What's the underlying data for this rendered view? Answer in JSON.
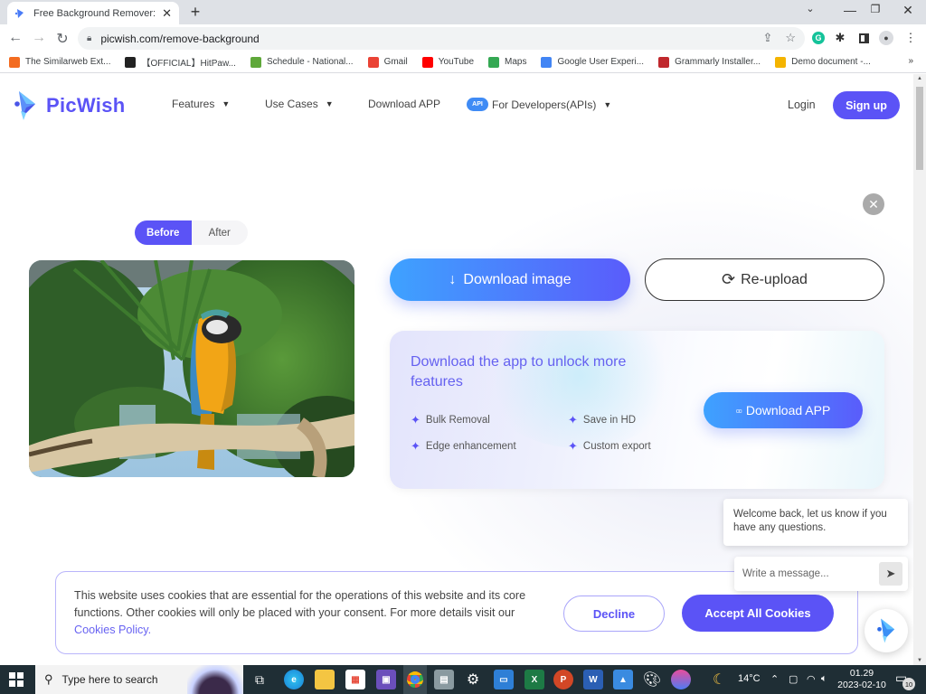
{
  "browser": {
    "tab_title": "Free Background Remover: Remo",
    "url": "picwish.com/remove-background",
    "bookmarks": [
      {
        "label": "The Similarweb Ext...",
        "icon": "similarweb-icon",
        "color": "#f36c21"
      },
      {
        "label": "【OFFICIAL】HitPaw...",
        "icon": "hitpaw-icon",
        "color": "#222222"
      },
      {
        "label": "Schedule - National...",
        "icon": "schedule-icon",
        "color": "#5fa83a"
      },
      {
        "label": "Gmail",
        "icon": "gmail-icon",
        "color": "#ea4335"
      },
      {
        "label": "YouTube",
        "icon": "youtube-icon",
        "color": "#ff0000"
      },
      {
        "label": "Maps",
        "icon": "maps-icon",
        "color": "#34a853"
      },
      {
        "label": "Google User Experi...",
        "icon": "google-icon",
        "color": "#4285f4"
      },
      {
        "label": "Grammarly Installer...",
        "icon": "grammarly-installer-icon",
        "color": "#c0282d"
      },
      {
        "label": "Demo document -...",
        "icon": "demo-document-icon",
        "color": "#f4b400"
      }
    ],
    "more_bookmarks": "»"
  },
  "header": {
    "logo_text": "PicWish",
    "nav": [
      {
        "label": "Features",
        "dropdown": true
      },
      {
        "label": "Use Cases",
        "dropdown": true
      },
      {
        "label": "Download APP",
        "dropdown": false
      },
      {
        "label": "For Developers(APIs)",
        "dropdown": true,
        "badge": "API"
      }
    ],
    "login": "Login",
    "signup": "Sign up"
  },
  "editor": {
    "toggle": {
      "before": "Before",
      "after": "After",
      "selected": "Before"
    },
    "download_image": "Download image",
    "reupload": "Re-upload"
  },
  "promo": {
    "title": "Download the app to unlock more features",
    "features": [
      "Bulk Removal",
      "Save in HD",
      "Edge enhancement",
      "Custom export"
    ],
    "button": "Download APP"
  },
  "chat": {
    "welcome": "Welcome back, let us know if you have any questions.",
    "placeholder": "Write a message..."
  },
  "cookie": {
    "text": "This website uses cookies that are essential for the operations of this website and its core functions. Other cookies will only be placed with your consent. For more details visit our ",
    "link": "Cookies Policy.",
    "decline": "Decline",
    "accept": "Accept All Cookies"
  },
  "taskbar": {
    "search_placeholder": "Type here to search",
    "weather": "14°C",
    "time": "01.29",
    "date": "2023-02-10",
    "notifications": "10"
  },
  "colors": {
    "brand": "#5b53f6",
    "gradient_start": "#3ea2ff",
    "gradient_end": "#5a5cfb"
  }
}
